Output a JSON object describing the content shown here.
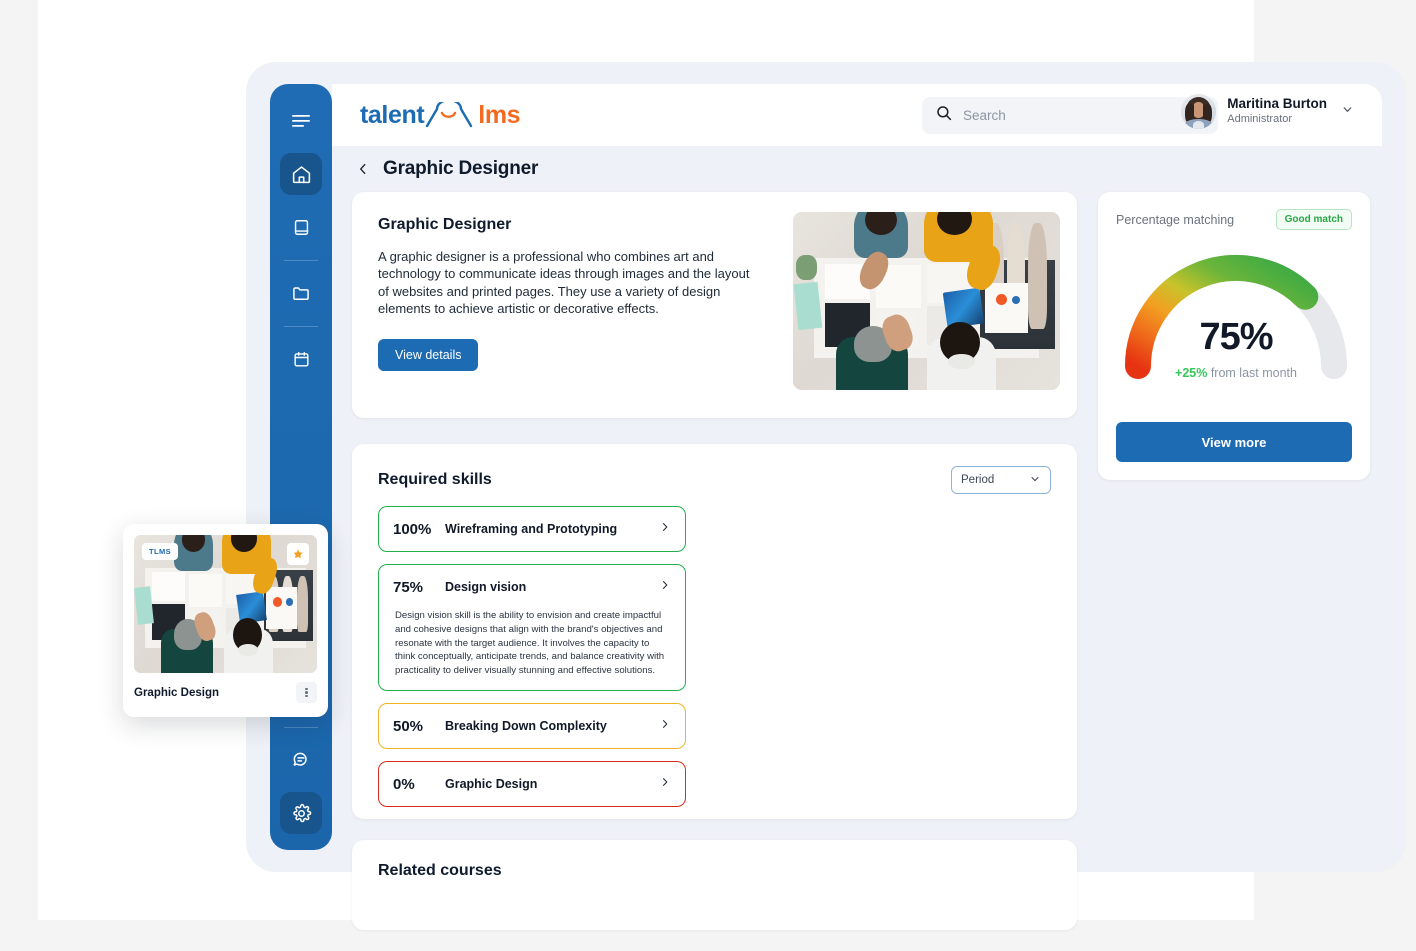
{
  "app": {
    "logo_talent": "talent",
    "logo_lms": "lms",
    "logo_mark": "cloud-smile-icon"
  },
  "search": {
    "placeholder": "Search",
    "value": "",
    "icon": "search-icon"
  },
  "user": {
    "name": "Maritina Burton",
    "role": "Administrator",
    "caret": "chevron-down-icon",
    "avatar": "user-avatar"
  },
  "sidebar": {
    "items": [
      {
        "icon": "hamburger-menu-icon",
        "name": "menu-toggle",
        "active": false
      },
      {
        "icon": "home-icon",
        "name": "home",
        "active": true
      },
      {
        "icon": "book-icon",
        "name": "courses",
        "active": false
      },
      {
        "icon": "folder-icon",
        "name": "files",
        "active": false
      },
      {
        "icon": "calendar-icon",
        "name": "calendar",
        "active": false
      }
    ],
    "bottom_items": [
      {
        "icon": "inbox-icon",
        "name": "inbox",
        "active": false
      },
      {
        "icon": "chat-bubble-icon",
        "name": "messages",
        "active": false
      },
      {
        "icon": "gear-icon",
        "name": "settings",
        "active": true
      }
    ]
  },
  "page": {
    "back_icon": "chevron-left-icon",
    "title": "Graphic Designer"
  },
  "hero": {
    "title": "Graphic Designer",
    "description": "A graphic designer is a professional who combines art and technology to communicate ideas through images and the layout of websites and printed pages. They use a variety of design elements to achieve artistic or decorative effects.",
    "button": "View details",
    "photo_alt": "team-collaborating-on-design-layouts"
  },
  "skills": {
    "title": "Required skills",
    "period_label": "Period",
    "period_caret": "chevron-down-icon",
    "items": [
      {
        "percent": "100%",
        "name": "Wireframing and Prototyping",
        "color": "#22b14c",
        "expanded": false,
        "description": ""
      },
      {
        "percent": "75%",
        "name": "Design vision",
        "color": "#22b14c",
        "expanded": true,
        "description": "Design vision skill is the ability to envision and create impactful and cohesive designs that align with the brand's objectives and resonate with the target audience. It involves the capacity to think conceptually, anticipate trends, and balance creativity with practicality to deliver visually stunning and effective solutions."
      },
      {
        "percent": "50%",
        "name": "Breaking Down Complexity",
        "color": "#f0b429",
        "expanded": false,
        "description": ""
      },
      {
        "percent": "0%",
        "name": "Graphic Design",
        "color": "#d92d20",
        "expanded": false,
        "description": ""
      }
    ]
  },
  "related": {
    "title": "Related courses"
  },
  "match": {
    "label": "Percentage matching",
    "badge": "Good match",
    "value": "75%",
    "delta": "+25%",
    "delta_suffix": " from last month",
    "button": "View more"
  },
  "float_card": {
    "badge": "TLMS",
    "star_icon": "star-icon",
    "title": "Graphic Design",
    "menu_icon": "more-vertical-icon"
  },
  "chart_data": {
    "type": "gauge",
    "title": "Percentage matching",
    "value": 75,
    "min": 0,
    "max": 100,
    "unit": "%",
    "track_color": "#e6e8ec",
    "gradient_stops": [
      "#e63312",
      "#ef6b1b",
      "#f2a022",
      "#c8c32a",
      "#6cb53a",
      "#35a845"
    ],
    "annotation": "+25% from last month",
    "status": "Good match"
  }
}
